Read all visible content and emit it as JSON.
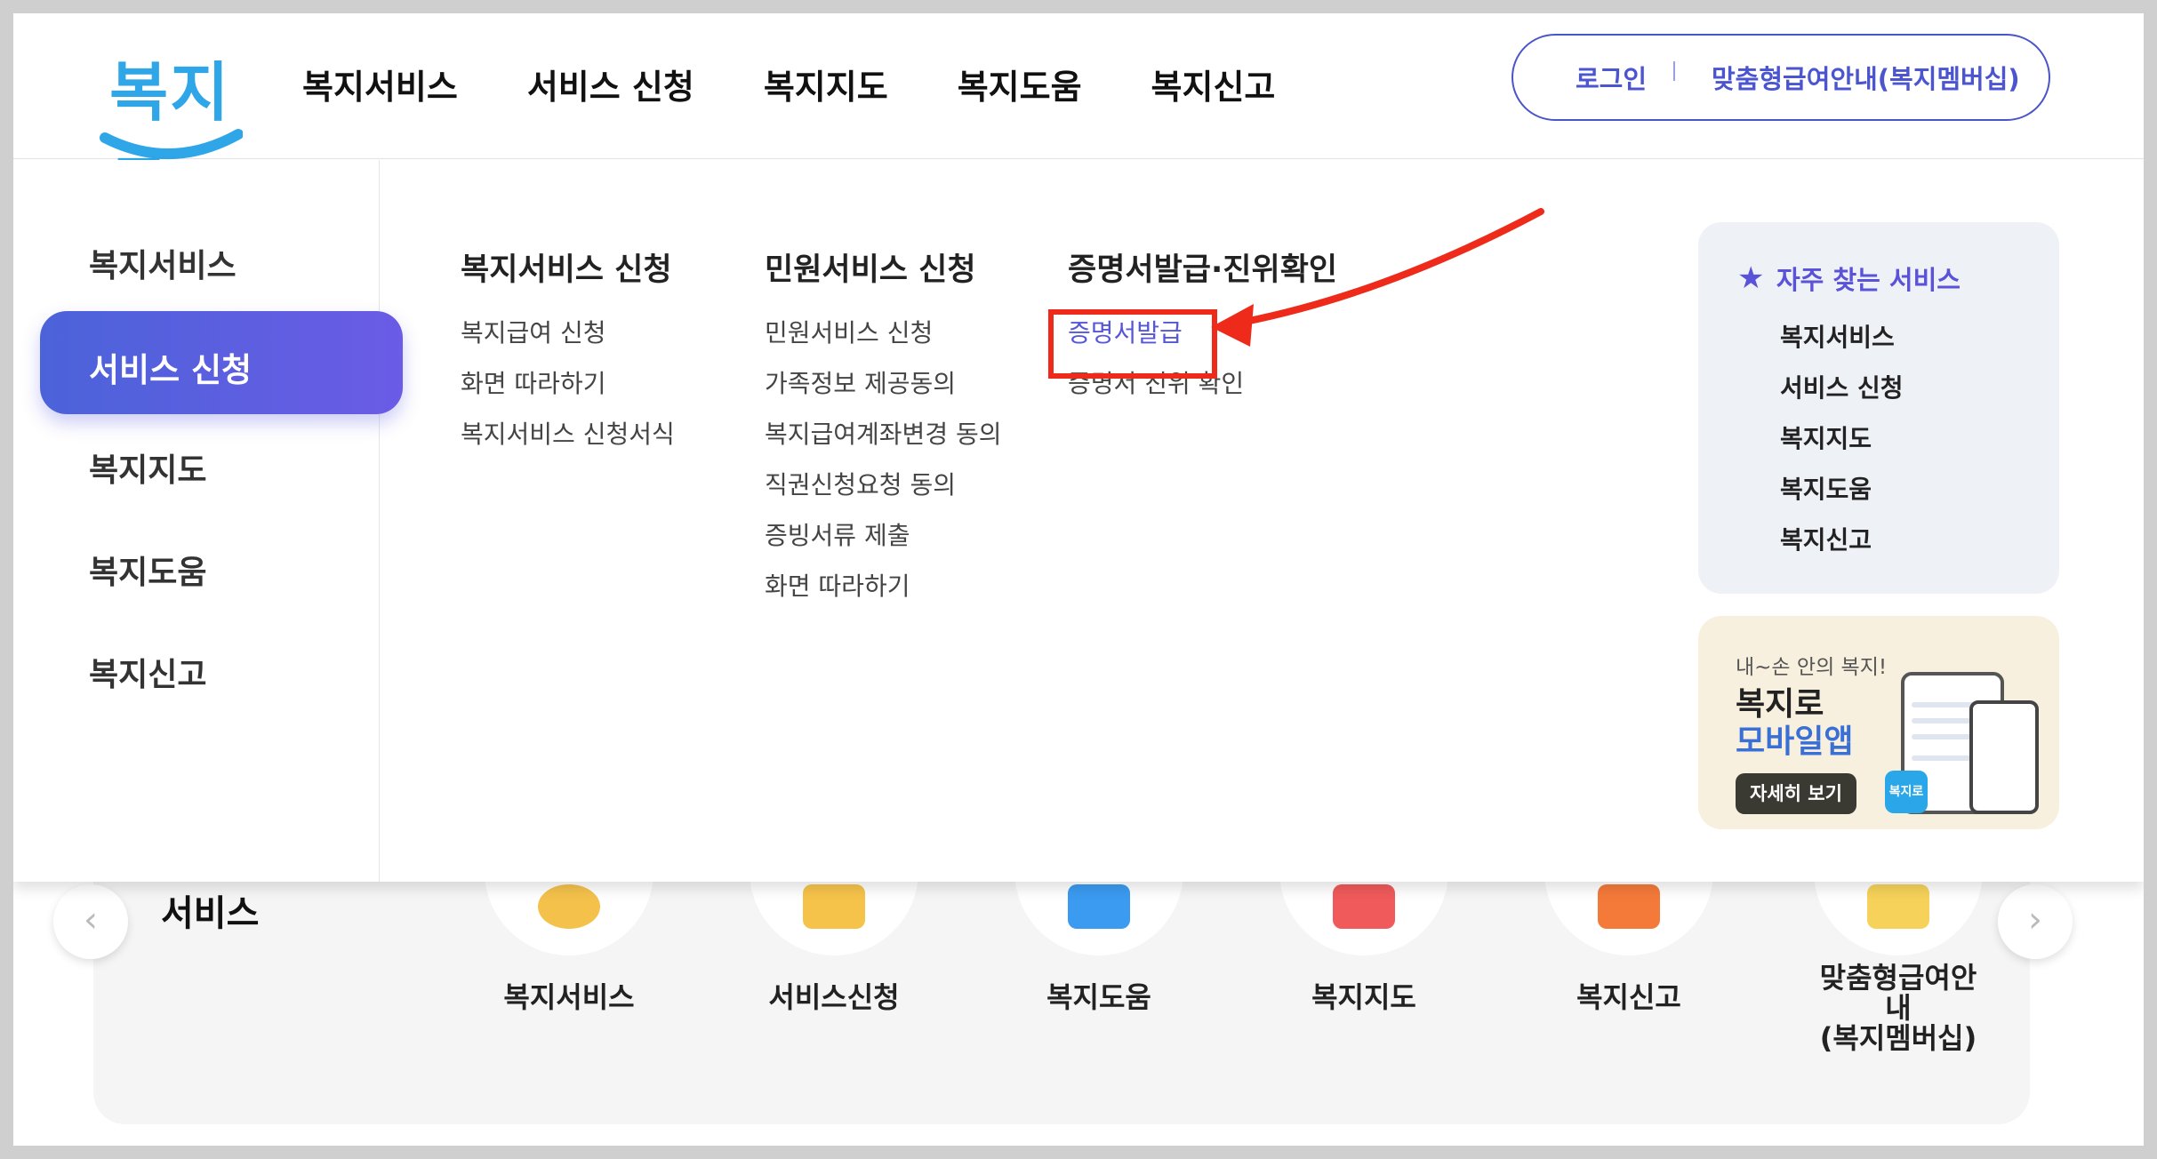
{
  "header": {
    "logo_text": "복지로",
    "gnb": [
      "복지서비스",
      "서비스 신청",
      "복지지도",
      "복지도움",
      "복지신고"
    ],
    "login_label": "로그인",
    "member_label": "맞춤형급여안내(복지멤버십)"
  },
  "lnb": {
    "items": [
      "복지서비스",
      "서비스 신청",
      "복지지도",
      "복지도움",
      "복지신고"
    ],
    "active": "서비스 신청"
  },
  "columns": [
    {
      "title": "복지서비스 신청",
      "links": [
        "복지급여 신청",
        "화면 따라하기",
        "복지서비스 신청서식"
      ]
    },
    {
      "title": "민원서비스 신청",
      "links": [
        "민원서비스 신청",
        "가족정보 제공동의",
        "복지급여계좌변경 동의",
        "직권신청요청 동의",
        "증빙서류 제출",
        "화면 따라하기"
      ]
    },
    {
      "title": "증명서발급·진위확인",
      "links": [
        "증명서발급",
        "증명서 진위 확인"
      ]
    }
  ],
  "favorites": {
    "title": "자주 찾는 서비스",
    "icon": "star-icon",
    "links": [
      "복지서비스",
      "서비스 신청",
      "복지지도",
      "복지도움",
      "복지신고"
    ]
  },
  "app_promo": {
    "subtitle": "내~손 안의 복지!",
    "title_line1": "복지로",
    "title_line2": "모바일앱",
    "button": "자세히 보기",
    "icon_text": "복지로"
  },
  "services": {
    "title": "서비스",
    "prev_icon": "chevron-left-icon",
    "next_icon": "chevron-right-icon",
    "items": [
      {
        "label": "복지서비스",
        "color": "#f4c24b"
      },
      {
        "label": "서비스신청",
        "color": "#f6c34a"
      },
      {
        "label": "복지도움",
        "color": "#3b9bf0"
      },
      {
        "label": "복지지도",
        "color": "#f05a5a"
      },
      {
        "label": "복지신고",
        "color": "#f47a3a"
      },
      {
        "label": "맞춤형급여안내\n(복지멤버십)",
        "color": "#f6d25a"
      }
    ]
  },
  "colors": {
    "accent": "#5a52d8",
    "highlight_box": "#ee2a1a",
    "logo": "#2fa6e8"
  }
}
